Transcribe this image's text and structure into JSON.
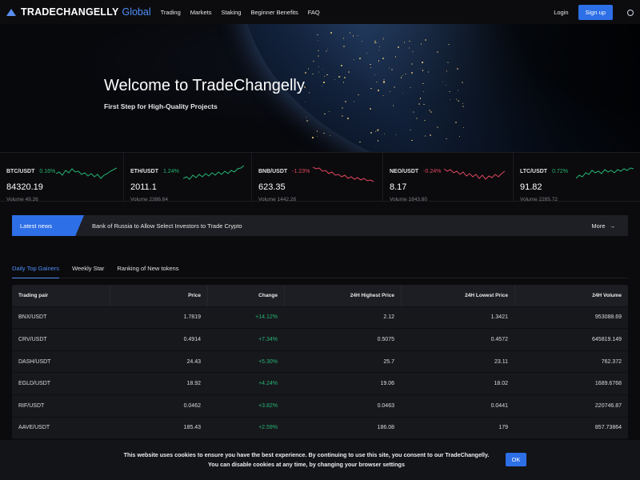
{
  "nav": {
    "logo_main": "TRADECHANGELLY",
    "logo_sub": "Global",
    "links": [
      "Trading",
      "Markets",
      "Staking",
      "Beginner Benefits",
      "FAQ"
    ],
    "login": "Login",
    "signup": "Sign up",
    "theme_icon": "sun-icon"
  },
  "hero": {
    "title": "Welcome to TradeChangelly",
    "subtitle": "First Step for High-Quality Projects"
  },
  "tickers": [
    {
      "pair": "BTC/USDT",
      "change": "0.16%",
      "dir": "up",
      "price": "84320.19",
      "volume": "Volume 49.26"
    },
    {
      "pair": "ETH/USDT",
      "change": "1.24%",
      "dir": "up",
      "price": "2011.1",
      "volume": "Volume 2386.64"
    },
    {
      "pair": "BNB/USDT",
      "change": "-1.23%",
      "dir": "down",
      "price": "623.35",
      "volume": "Volume 1442.28"
    },
    {
      "pair": "NEO/USDT",
      "change": "-0.24%",
      "dir": "down",
      "price": "8.17",
      "volume": "Volume 1843.80"
    },
    {
      "pair": "LTC/USDT",
      "change": "0.72%",
      "dir": "up",
      "price": "91.82",
      "volume": "Volume 2285.72"
    }
  ],
  "colors": {
    "up": "#26b574",
    "down": "#e0475f",
    "accent": "#2d6fe6"
  },
  "news": {
    "tag": "Latest news",
    "headline": "Bank of Russia to Allow Select Investors to Trade Crypto",
    "more": "More"
  },
  "tabs": [
    "Daily Top Gainers",
    "Weekly Star",
    "Ranking of New tokens"
  ],
  "table": {
    "headers": [
      "Trading pair",
      "Price",
      "Change",
      "24H Highest Price",
      "24H Lowest Price",
      "24H Volume"
    ],
    "rows": [
      [
        "BNX/USDT",
        "1.7819",
        "+14.12%",
        "2.12",
        "1.3421",
        "953088.69"
      ],
      [
        "CRV/USDT",
        "0.4914",
        "+7.34%",
        "0.5075",
        "0.4572",
        "645819.149"
      ],
      [
        "DASH/USDT",
        "24.43",
        "+5.30%",
        "25.7",
        "23.11",
        "762.372"
      ],
      [
        "EGLD/USDT",
        "18.92",
        "+4.24%",
        "19.06",
        "18.02",
        "1689.6768"
      ],
      [
        "RIF/USDT",
        "0.0462",
        "+3.82%",
        "0.0463",
        "0.0441",
        "220746.87"
      ],
      [
        "AAVE/USDT",
        "185.43",
        "+2.59%",
        "186.08",
        "179",
        "857.73864"
      ]
    ]
  },
  "cookie": {
    "text": "This website uses cookies to ensure you have the best experience. By continuing to use this site, you consent to our TradeChangelly. You can disable cookies at any time, by changing your browser settings",
    "ok": "OK"
  }
}
